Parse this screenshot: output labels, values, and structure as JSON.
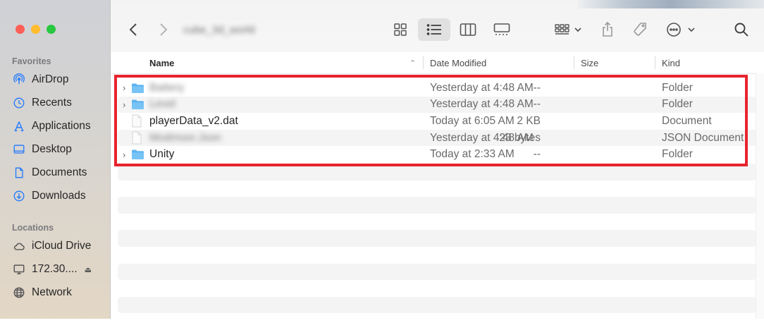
{
  "window": {
    "title": "cube_3d_world",
    "traffic_lights": [
      "close",
      "minimize",
      "zoom"
    ]
  },
  "sidebar": {
    "favorites_label": "Favorites",
    "favorites": [
      {
        "label": "AirDrop",
        "icon": "airdrop-icon"
      },
      {
        "label": "Recents",
        "icon": "clock-icon"
      },
      {
        "label": "Applications",
        "icon": "applications-icon"
      },
      {
        "label": "Desktop",
        "icon": "desktop-icon"
      },
      {
        "label": "Documents",
        "icon": "document-icon"
      },
      {
        "label": "Downloads",
        "icon": "download-icon"
      }
    ],
    "locations_label": "Locations",
    "locations": [
      {
        "label": "iCloud Drive",
        "icon": "cloud-icon"
      },
      {
        "label": "172.30....",
        "icon": "display-icon",
        "eject": "⏏"
      },
      {
        "label": "Network",
        "icon": "globe-icon"
      }
    ]
  },
  "toolbar": {
    "back": "back-chevron-icon",
    "forward": "forward-chevron-icon",
    "views": [
      "icon-view",
      "list-view",
      "column-view",
      "gallery-view"
    ],
    "selected_view": "list-view",
    "group": "group-by-icon",
    "share": "share-icon",
    "tag": "tag-icon",
    "more": "more-options-icon",
    "search": "search-icon"
  },
  "columns": {
    "name": "Name",
    "date_modified": "Date Modified",
    "size": "Size",
    "kind": "Kind",
    "sort_indicator": "⌃"
  },
  "files": [
    {
      "name": "Battery",
      "blurred": true,
      "type": "folder",
      "expandable": true,
      "date": "Yesterday at 4:48 AM",
      "size": "--",
      "kind": "Folder"
    },
    {
      "name": "Level",
      "blurred": true,
      "type": "folder",
      "expandable": true,
      "date": "Yesterday at 4:48 AM",
      "size": "--",
      "kind": "Folder"
    },
    {
      "name": "playerData_v2.dat",
      "blurred": false,
      "type": "document",
      "expandable": false,
      "date": "Today at 6:05 AM",
      "size": "2 KB",
      "kind": "Document"
    },
    {
      "name": "Modmoor.Json",
      "blurred": true,
      "type": "document",
      "expandable": false,
      "date": "Yesterday at 4:48 AM",
      "size": "23 bytes",
      "kind": "JSON Document"
    },
    {
      "name": "Unity",
      "blurred": false,
      "type": "folder",
      "expandable": true,
      "date": "Today at 2:33 AM",
      "size": "--",
      "kind": "Folder"
    }
  ],
  "colors": {
    "highlight_box": "#e8242e",
    "folder_blue": "#5fb4f0",
    "sidebar_accent": "#2d7ff9"
  }
}
